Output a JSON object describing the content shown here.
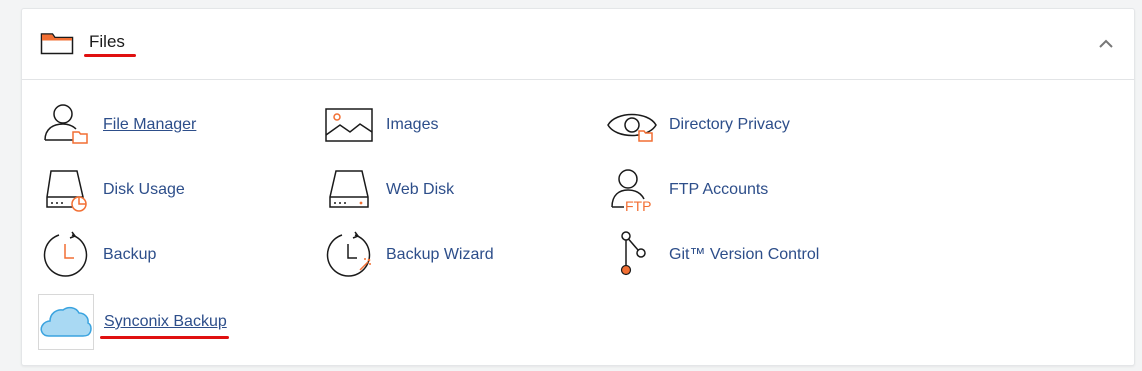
{
  "section": {
    "title": "Files",
    "collapse_icon": "chevron-up-icon",
    "icon": "folder-icon"
  },
  "colors": {
    "link": "#2d4e8a",
    "accent_orange": "#f26f33",
    "highlight_red": "#e01010"
  },
  "items": [
    {
      "label": "File Manager",
      "icon": "file-manager-icon"
    },
    {
      "label": "Images",
      "icon": "images-icon"
    },
    {
      "label": "Directory Privacy",
      "icon": "directory-privacy-icon"
    },
    {
      "label": "Disk Usage",
      "icon": "disk-usage-icon"
    },
    {
      "label": "Web Disk",
      "icon": "web-disk-icon"
    },
    {
      "label": "FTP Accounts",
      "icon": "ftp-accounts-icon"
    },
    {
      "label": "Backup",
      "icon": "backup-icon"
    },
    {
      "label": "Backup Wizard",
      "icon": "backup-wizard-icon"
    },
    {
      "label": "Git™ Version Control",
      "icon": "git-icon"
    },
    {
      "label": "Synconix Backup",
      "icon": "cloud-icon"
    }
  ],
  "ftp_icon_text": "FTP"
}
